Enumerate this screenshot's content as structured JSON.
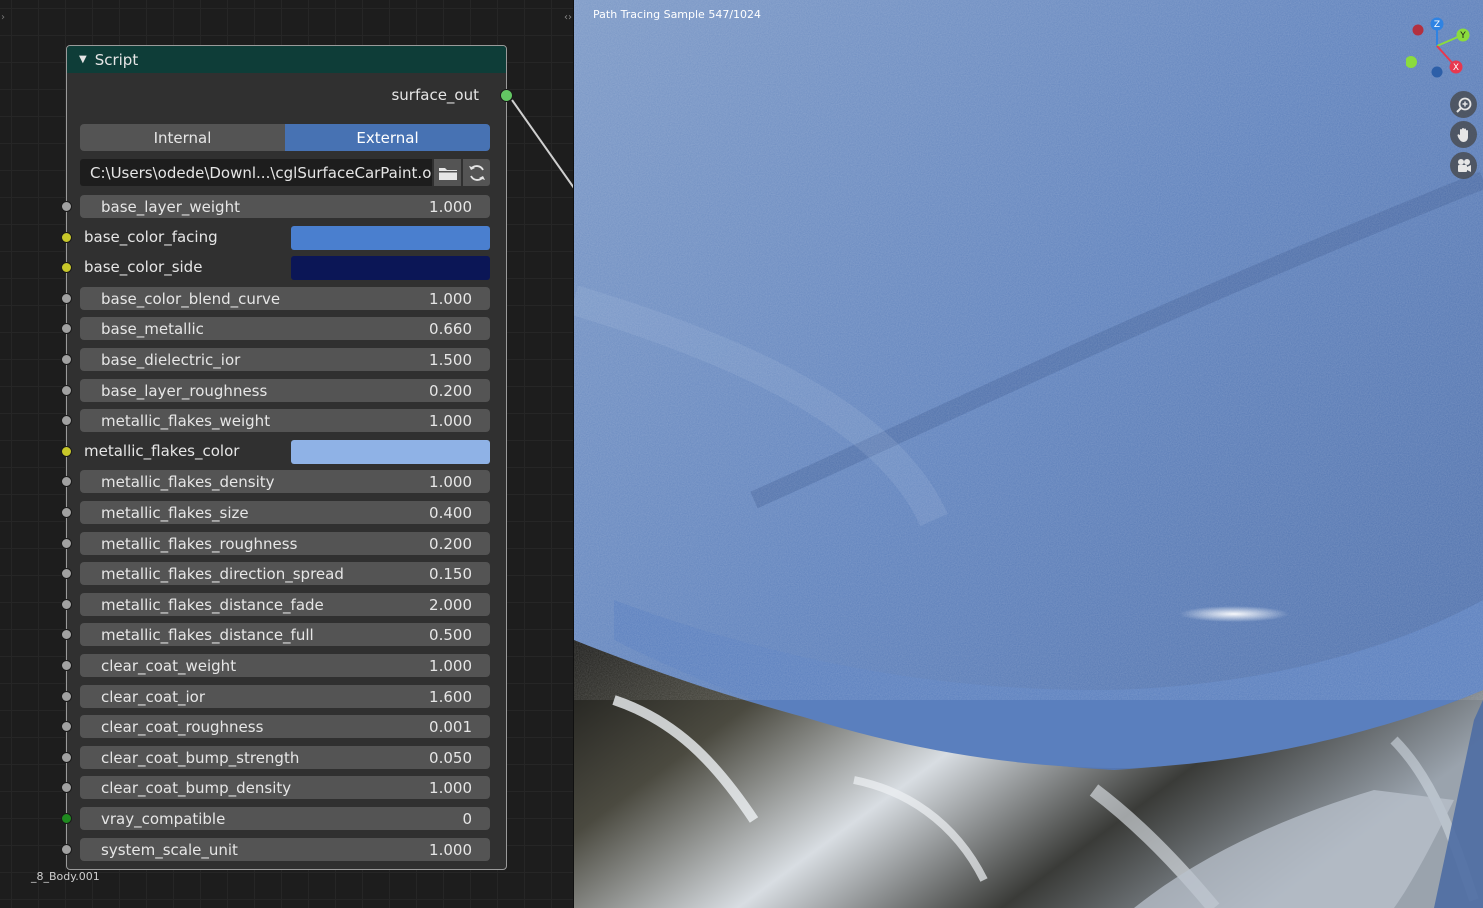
{
  "node": {
    "title": "Script",
    "output_label": "surface_out",
    "mode_tabs": [
      {
        "label": "Internal",
        "active": false
      },
      {
        "label": "External",
        "active": true
      }
    ],
    "filepath": "C:\\Users\\odede\\Downl...\\cglSurfaceCarPaint.osl",
    "params": [
      {
        "type": "number",
        "name": "base_layer_weight",
        "value": "1.000",
        "socket": "gray"
      },
      {
        "type": "color",
        "name": "base_color_facing",
        "color": "#4a7fcf",
        "socket": "yellow"
      },
      {
        "type": "color",
        "name": "base_color_side",
        "color": "#0b1656",
        "socket": "yellow"
      },
      {
        "type": "number",
        "name": "base_color_blend_curve",
        "value": "1.000",
        "socket": "gray"
      },
      {
        "type": "number",
        "name": "base_metallic",
        "value": "0.660",
        "socket": "gray"
      },
      {
        "type": "number",
        "name": "base_dielectric_ior",
        "value": "1.500",
        "socket": "gray"
      },
      {
        "type": "number",
        "name": "base_layer_roughness",
        "value": "0.200",
        "socket": "gray"
      },
      {
        "type": "number",
        "name": "metallic_flakes_weight",
        "value": "1.000",
        "socket": "gray"
      },
      {
        "type": "color",
        "name": "metallic_flakes_color",
        "color": "#8fb2e6",
        "socket": "yellow"
      },
      {
        "type": "number",
        "name": "metallic_flakes_density",
        "value": "1.000",
        "socket": "gray"
      },
      {
        "type": "number",
        "name": "metallic_flakes_size",
        "value": "0.400",
        "socket": "gray"
      },
      {
        "type": "number",
        "name": "metallic_flakes_roughness",
        "value": "0.200",
        "socket": "gray"
      },
      {
        "type": "number",
        "name": "metallic_flakes_direction_spread",
        "value": "0.150",
        "socket": "gray"
      },
      {
        "type": "number",
        "name": "metallic_flakes_distance_fade",
        "value": "2.000",
        "socket": "gray"
      },
      {
        "type": "number",
        "name": "metallic_flakes_distance_full",
        "value": "0.500",
        "socket": "gray"
      },
      {
        "type": "number",
        "name": "clear_coat_weight",
        "value": "1.000",
        "socket": "gray"
      },
      {
        "type": "number",
        "name": "clear_coat_ior",
        "value": "1.600",
        "socket": "gray"
      },
      {
        "type": "number",
        "name": "clear_coat_roughness",
        "value": "0.001",
        "socket": "gray"
      },
      {
        "type": "number",
        "name": "clear_coat_bump_strength",
        "value": "0.050",
        "socket": "gray"
      },
      {
        "type": "number",
        "name": "clear_coat_bump_density",
        "value": "1.000",
        "socket": "gray"
      },
      {
        "type": "number",
        "name": "vray_compatible",
        "value": "0",
        "socket": "green"
      },
      {
        "type": "number",
        "name": "system_scale_unit",
        "value": "1.000",
        "socket": "gray"
      }
    ]
  },
  "node_editor": {
    "object_label": "_8_Body.001"
  },
  "viewport": {
    "status": "Path Tracing Sample 547/1024",
    "gizmo": {
      "z_label": "Z",
      "y_label": "Y",
      "x_label": "X",
      "colors": {
        "x": "#e8384f",
        "y": "#8bdc3d",
        "z": "#2f83e3"
      }
    },
    "nav_buttons": [
      "zoom-icon",
      "hand-icon",
      "camera-icon"
    ]
  }
}
